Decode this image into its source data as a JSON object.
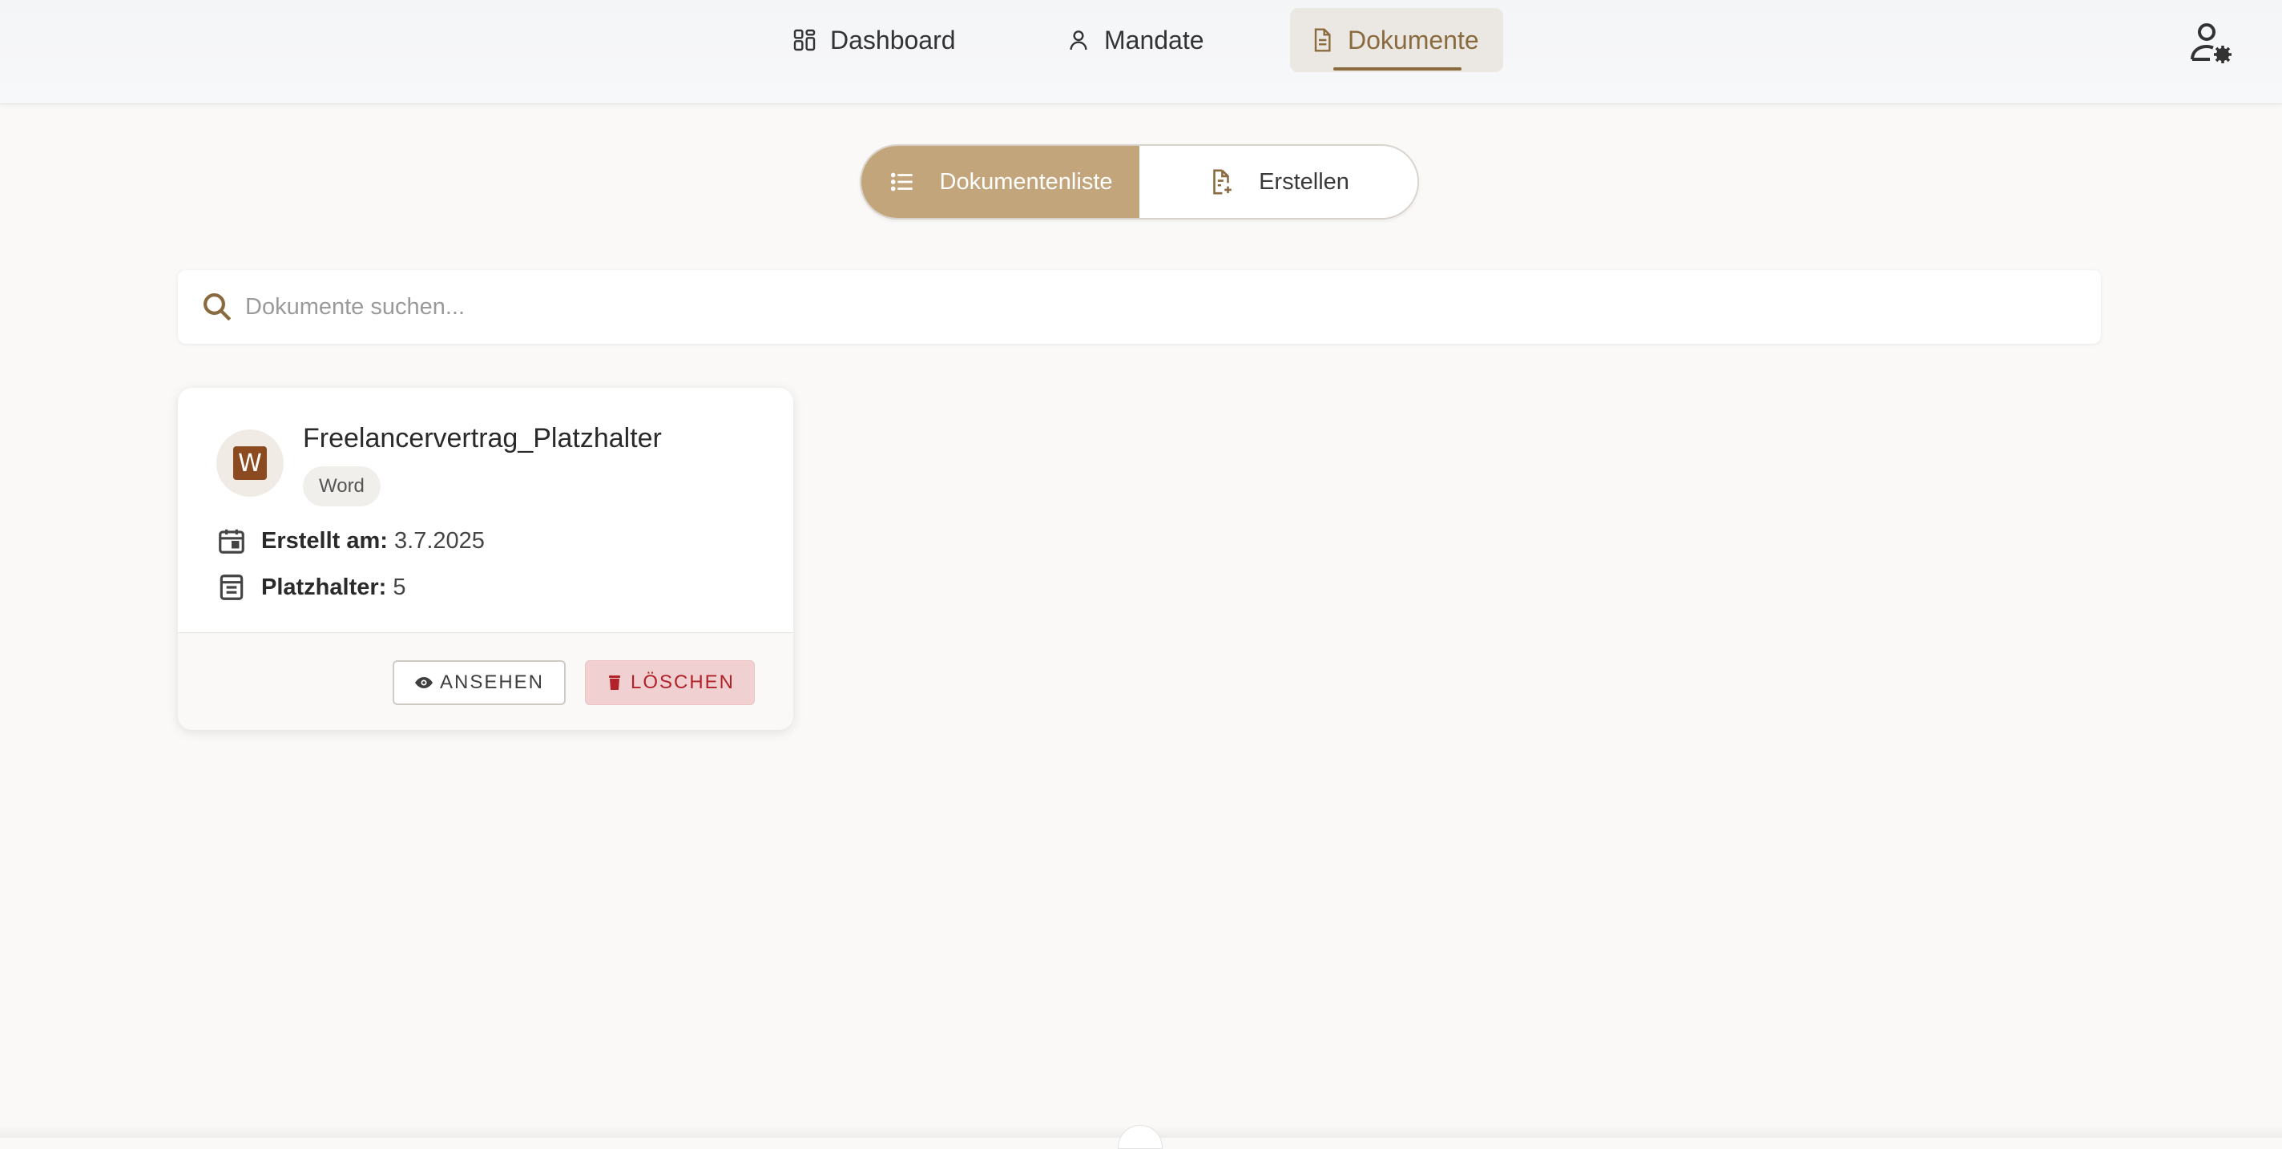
{
  "nav": {
    "items": [
      {
        "label": "Dashboard",
        "icon": "dashboard-grid-icon"
      },
      {
        "label": "Mandate",
        "icon": "person-icon"
      },
      {
        "label": "Dokumente",
        "icon": "document-icon",
        "active": true
      }
    ],
    "user_settings_icon": "user-settings-icon"
  },
  "view_toggle": {
    "list_label": "Dokumentenliste",
    "create_label": "Erstellen",
    "active": "list"
  },
  "search": {
    "placeholder": "Dokumente suchen...",
    "value": ""
  },
  "documents": [
    {
      "title": "Freelancervertrag_Platzhalter",
      "type": "Word",
      "icon_letter": "W",
      "created_label": "Erstellt am:",
      "created_value": "3.7.2025",
      "placeholders_label": "Platzhalter:",
      "placeholders_value": "5",
      "view_label": "ANSEHEN",
      "delete_label": "LÖSCHEN"
    }
  ],
  "colors": {
    "accent": "#c2a57b",
    "accent_dark": "#8a6a3f",
    "word_brand": "#8b4a20",
    "danger_bg": "#f0d0d0",
    "danger_text": "#b0232a"
  }
}
